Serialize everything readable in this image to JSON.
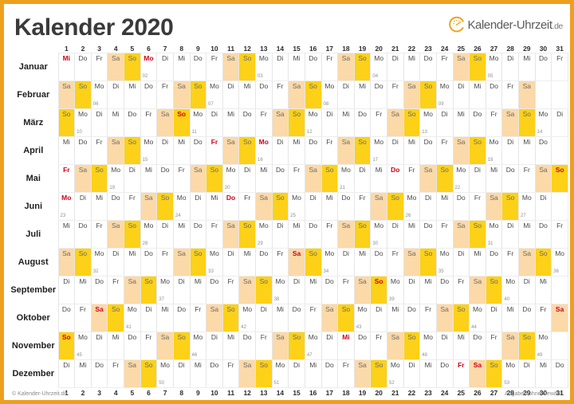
{
  "header": {
    "title": "Kalender 2020",
    "logo_text": "Kalender-Uhrzeit",
    "logo_tld": ".de",
    "logo_icon": "clock-arc-icon"
  },
  "footer": {
    "copyright": "© Kalender-Uhrzeit.de",
    "disclaimer": "Angaben ohne Gewähr"
  },
  "colors": {
    "border": "#eda01e",
    "saturday": "#fbd9a8",
    "sunday": "#fcd117",
    "holiday_text": "#d0021b",
    "title_text": "#3a3a3a",
    "grid_line": "#e6e6e6"
  },
  "grid": {
    "day_numbers": [
      1,
      2,
      3,
      4,
      5,
      6,
      7,
      8,
      9,
      10,
      11,
      12,
      13,
      14,
      15,
      16,
      17,
      18,
      19,
      20,
      21,
      22,
      23,
      24,
      25,
      26,
      27,
      28,
      29,
      30,
      31
    ],
    "weekday_abbr": [
      "Mo",
      "Di",
      "Mi",
      "Do",
      "Fr",
      "Sa",
      "So"
    ]
  },
  "months": [
    {
      "name": "Januar",
      "days": 31,
      "first_weekday": 2,
      "holidays": [
        1,
        6
      ],
      "weeks": {
        "6": "02",
        "13": "03",
        "20": "04",
        "27": "05"
      }
    },
    {
      "name": "Februar",
      "days": 29,
      "first_weekday": 5,
      "holidays": [],
      "weeks": {
        "3": "06",
        "10": "07",
        "17": "08",
        "24": "09"
      }
    },
    {
      "name": "März",
      "days": 31,
      "first_weekday": 6,
      "holidays": [
        8
      ],
      "weeks": {
        "2": "10",
        "9": "11",
        "16": "12",
        "23": "13",
        "30": "14"
      }
    },
    {
      "name": "April",
      "days": 30,
      "first_weekday": 2,
      "holidays": [
        10,
        13
      ],
      "weeks": {
        "6": "15",
        "13": "16",
        "20": "17",
        "27": "18"
      }
    },
    {
      "name": "Mai",
      "days": 31,
      "first_weekday": 4,
      "holidays": [
        1,
        21,
        31
      ],
      "weeks": {
        "4": "19",
        "11": "20",
        "18": "21",
        "25": "22"
      }
    },
    {
      "name": "Juni",
      "days": 30,
      "first_weekday": 0,
      "holidays": [
        1,
        11
      ],
      "weeks": {
        "1": "23",
        "8": "24",
        "15": "25",
        "22": "26",
        "29": "27"
      }
    },
    {
      "name": "Juli",
      "days": 31,
      "first_weekday": 2,
      "holidays": [],
      "weeks": {
        "6": "28",
        "13": "29",
        "20": "30",
        "27": "31"
      }
    },
    {
      "name": "August",
      "days": 31,
      "first_weekday": 5,
      "holidays": [
        15
      ],
      "weeks": {
        "3": "32",
        "10": "33",
        "17": "34",
        "24": "35",
        "31": "36"
      }
    },
    {
      "name": "September",
      "days": 30,
      "first_weekday": 1,
      "holidays": [
        20
      ],
      "weeks": {
        "7": "37",
        "14": "38",
        "21": "39",
        "28": "40"
      }
    },
    {
      "name": "Oktober",
      "days": 31,
      "first_weekday": 3,
      "holidays": [
        3,
        31
      ],
      "weeks": {
        "5": "41",
        "12": "42",
        "19": "43",
        "26": "44"
      }
    },
    {
      "name": "November",
      "days": 30,
      "first_weekday": 6,
      "holidays": [
        1,
        18
      ],
      "weeks": {
        "2": "45",
        "9": "46",
        "16": "47",
        "23": "48",
        "30": "49"
      }
    },
    {
      "name": "Dezember",
      "days": 31,
      "first_weekday": 1,
      "holidays": [
        25,
        26
      ],
      "weeks": {
        "7": "50",
        "14": "51",
        "21": "52",
        "28": "53"
      }
    }
  ]
}
